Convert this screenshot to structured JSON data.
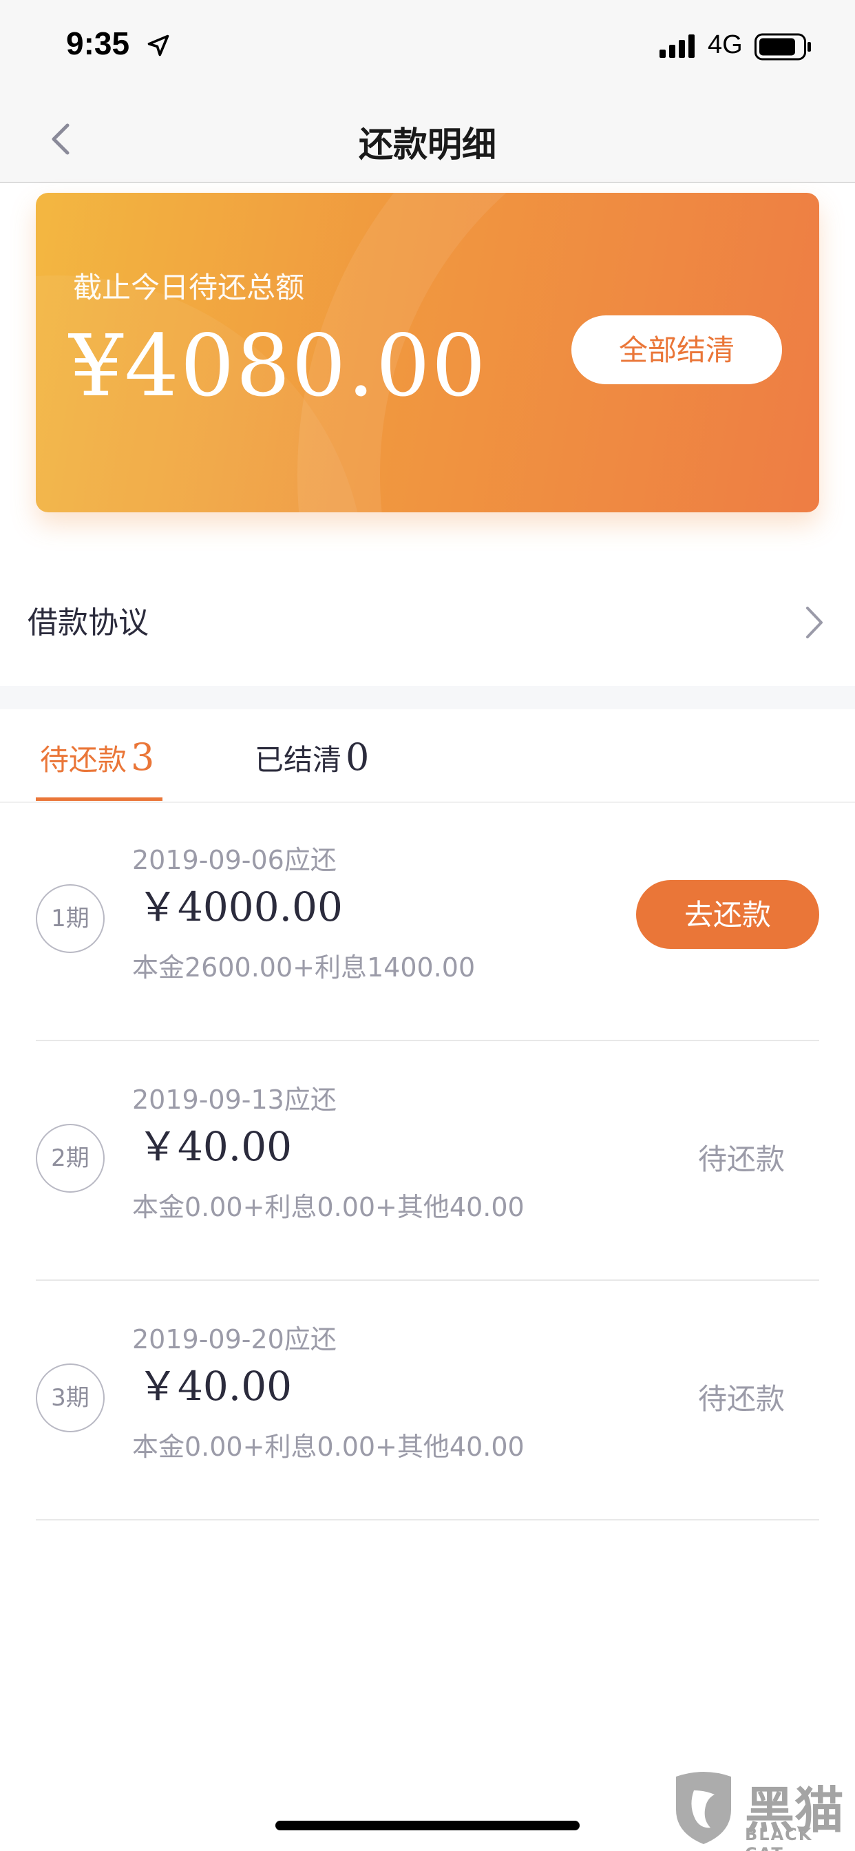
{
  "status_bar": {
    "time": "9:35",
    "network": "4G"
  },
  "nav": {
    "title": "还款明细"
  },
  "summary": {
    "label": "截止今日待还总额",
    "amount": "¥4080.00",
    "settle_all_label": "全部结清"
  },
  "agreement": {
    "label": "借款协议"
  },
  "tabs": [
    {
      "label": "待还款",
      "count": "3",
      "active": true
    },
    {
      "label": "已结清",
      "count": "0",
      "active": false
    }
  ],
  "installments": [
    {
      "period": "1期",
      "due_date": "2019-09-06应还",
      "amount": "￥4000.00",
      "breakdown": "本金2600.00+利息1400.00",
      "action_label": "去还款"
    },
    {
      "period": "2期",
      "due_date": "2019-09-13应还",
      "amount": "￥40.00",
      "breakdown": "本金0.00+利息0.00+其他40.00",
      "status": "待还款"
    },
    {
      "period": "3期",
      "due_date": "2019-09-20应还",
      "amount": "￥40.00",
      "breakdown": "本金0.00+利息0.00+其他40.00",
      "status": "待还款"
    }
  ],
  "watermark": {
    "text_cn": "黑猫",
    "text_en": "BLACK CAT"
  },
  "colors": {
    "accent": "#ea7638",
    "card_start": "#f3b741",
    "card_end": "#ee7d44"
  }
}
